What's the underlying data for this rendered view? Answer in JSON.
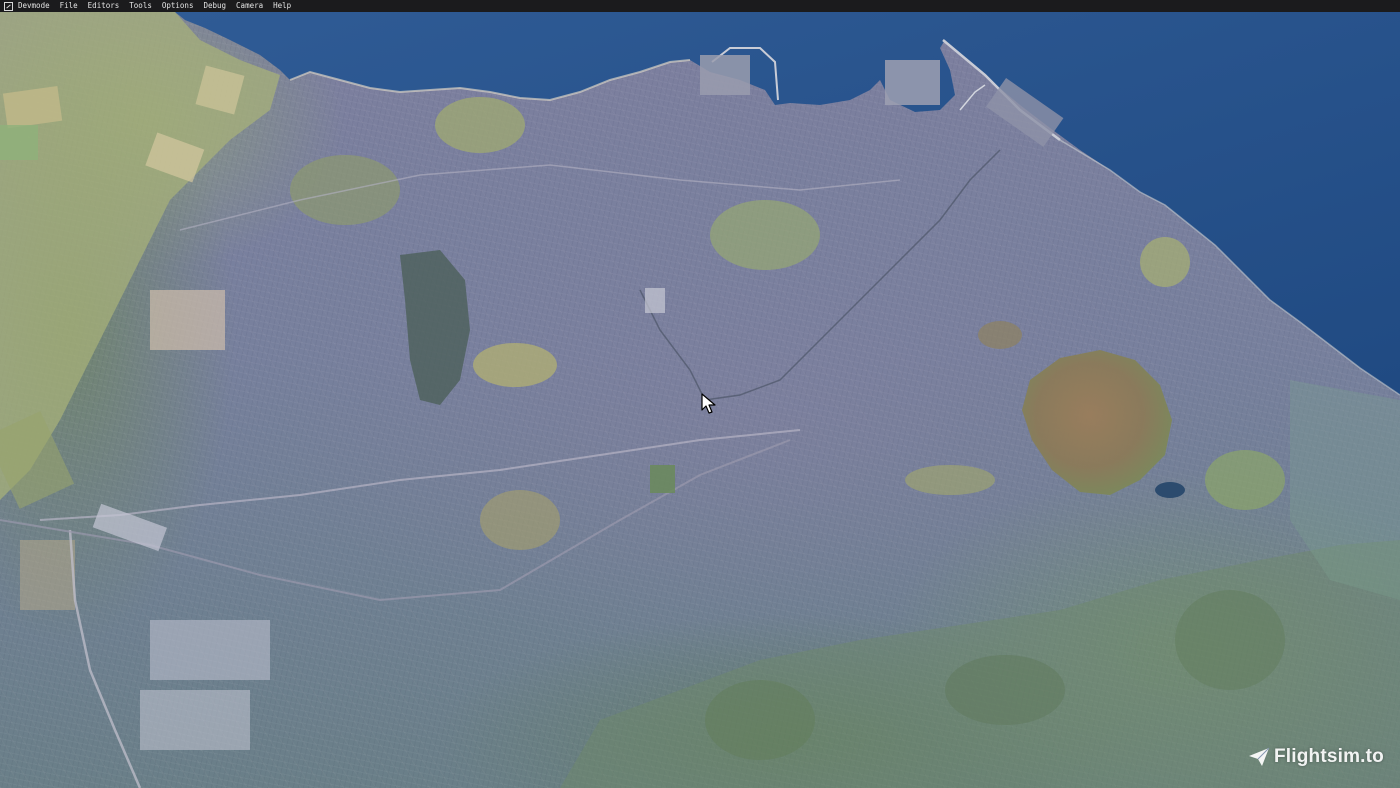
{
  "menu_bar": {
    "items": [
      "Devmode",
      "File",
      "Editors",
      "Tools",
      "Options",
      "Debug",
      "Camera",
      "Help"
    ]
  },
  "viewport": {
    "scene": "aerial-city-view",
    "colors": {
      "sea": "#2b5690",
      "sea_deep": "#21497f",
      "urban": "#7b7fa0",
      "parkland": "#8e9b6a",
      "hill": "#8a7456",
      "farmland": "#9aa875"
    }
  },
  "watermark": {
    "text": "Flightsim.to",
    "icon": "paper-plane-icon"
  },
  "cursor": {
    "icon": "mouse-pointer-icon"
  }
}
